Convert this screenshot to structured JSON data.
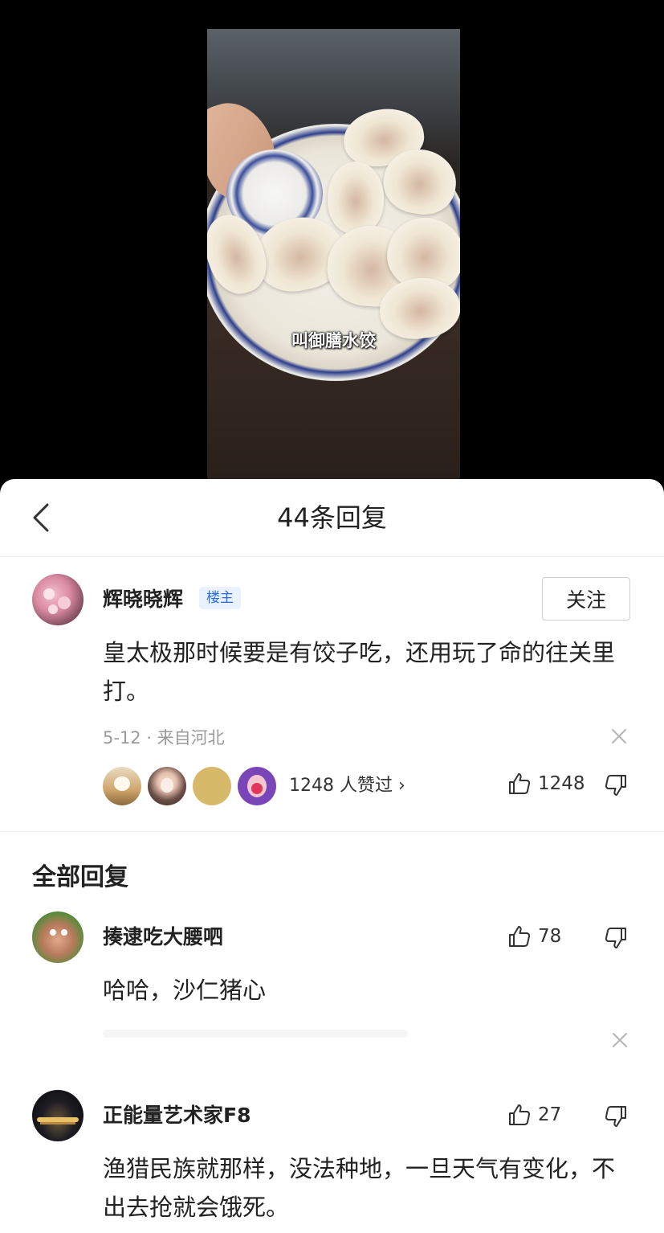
{
  "video": {
    "subtitle": "叫御膳水饺"
  },
  "sheet": {
    "title": "44条回复"
  },
  "main_comment": {
    "username": "辉晓晓辉",
    "badge": "楼主",
    "follow_label": "关注",
    "text": "皇太极那时候要是有饺子吃，还用玩了命的往关里打。",
    "meta": "5-12 · 来自河北",
    "likers_label": "1248 人赞过 ›",
    "like_count": "1248"
  },
  "replies_header": "全部回复",
  "replies": [
    {
      "username": "揍逮吃大腰呬",
      "text": "哈哈，沙仁猪心",
      "like_count": "78"
    },
    {
      "username": "正能量艺术家F8",
      "text": "渔猎民族就那样，没法种地，一旦天气有变化，不出去抢就会饿死。",
      "like_count": "27"
    }
  ],
  "colors": {
    "badge_text": "#2d6be4",
    "badge_bg": "#eaf2ff",
    "meta_text": "#9a9a9a"
  }
}
